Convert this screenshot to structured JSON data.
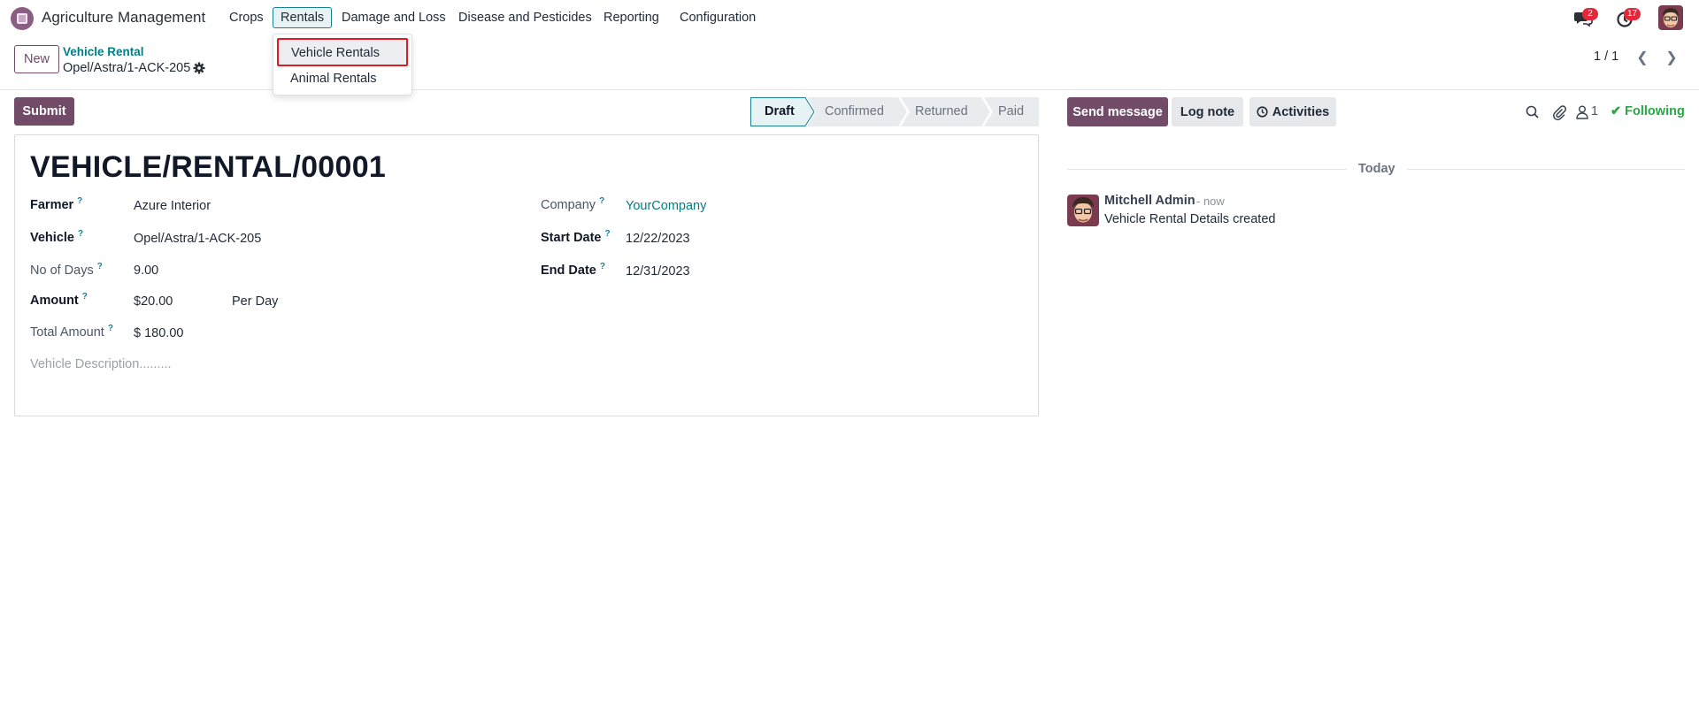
{
  "app": {
    "name": "Agriculture Management"
  },
  "menu": [
    {
      "label": "Crops"
    },
    {
      "label": "Rentals"
    },
    {
      "label": "Damage and Loss"
    },
    {
      "label": "Disease and Pesticides"
    },
    {
      "label": "Reporting"
    },
    {
      "label": "Configuration"
    }
  ],
  "rentals_dropdown": {
    "items": [
      {
        "label": "Vehicle Rentals"
      },
      {
        "label": "Animal Rentals"
      }
    ]
  },
  "systray": {
    "messages_badge": "2",
    "activities_badge": "17"
  },
  "control_panel": {
    "new_label": "New",
    "breadcrumb": "Vehicle Rental",
    "record_name": "Opel/Astra/1-ACK-205",
    "pager": "1 / 1"
  },
  "statusbar": {
    "submit_label": "Submit",
    "stages": [
      {
        "label": "Draft",
        "active": true
      },
      {
        "label": "Confirmed",
        "active": false
      },
      {
        "label": "Returned",
        "active": false
      },
      {
        "label": "Paid",
        "active": false
      }
    ]
  },
  "form": {
    "title": "VEHICLE/RENTAL/00001",
    "farmer_label": "Farmer",
    "farmer_value": "Azure Interior",
    "vehicle_label": "Vehicle",
    "vehicle_value": "Opel/Astra/1-ACK-205",
    "days_label": "No of Days",
    "days_value": "9.00",
    "amount_label": "Amount",
    "amount_value": "$20.00",
    "amount_unit": "Per Day",
    "total_label": "Total Amount",
    "total_value": "$ 180.00",
    "description_placeholder": "Vehicle Description.........",
    "company_label": "Company",
    "company_value": "YourCompany",
    "start_label": "Start Date",
    "start_value": "12/22/2023",
    "end_label": "End Date",
    "end_value": "12/31/2023",
    "help_mark": "?"
  },
  "chatter": {
    "send_label": "Send message",
    "log_label": "Log note",
    "activities_label": "Activities",
    "followers_count": "1",
    "following_label": "Following",
    "today_label": "Today",
    "message": {
      "author": "Mitchell Admin",
      "time": "- now",
      "body": "Vehicle Rental Details created"
    }
  },
  "colors": {
    "brand": "#714b67",
    "link": "#017e84",
    "highlight_border": "#e01b24",
    "following": "#28a745",
    "badge": "#e4283a"
  }
}
